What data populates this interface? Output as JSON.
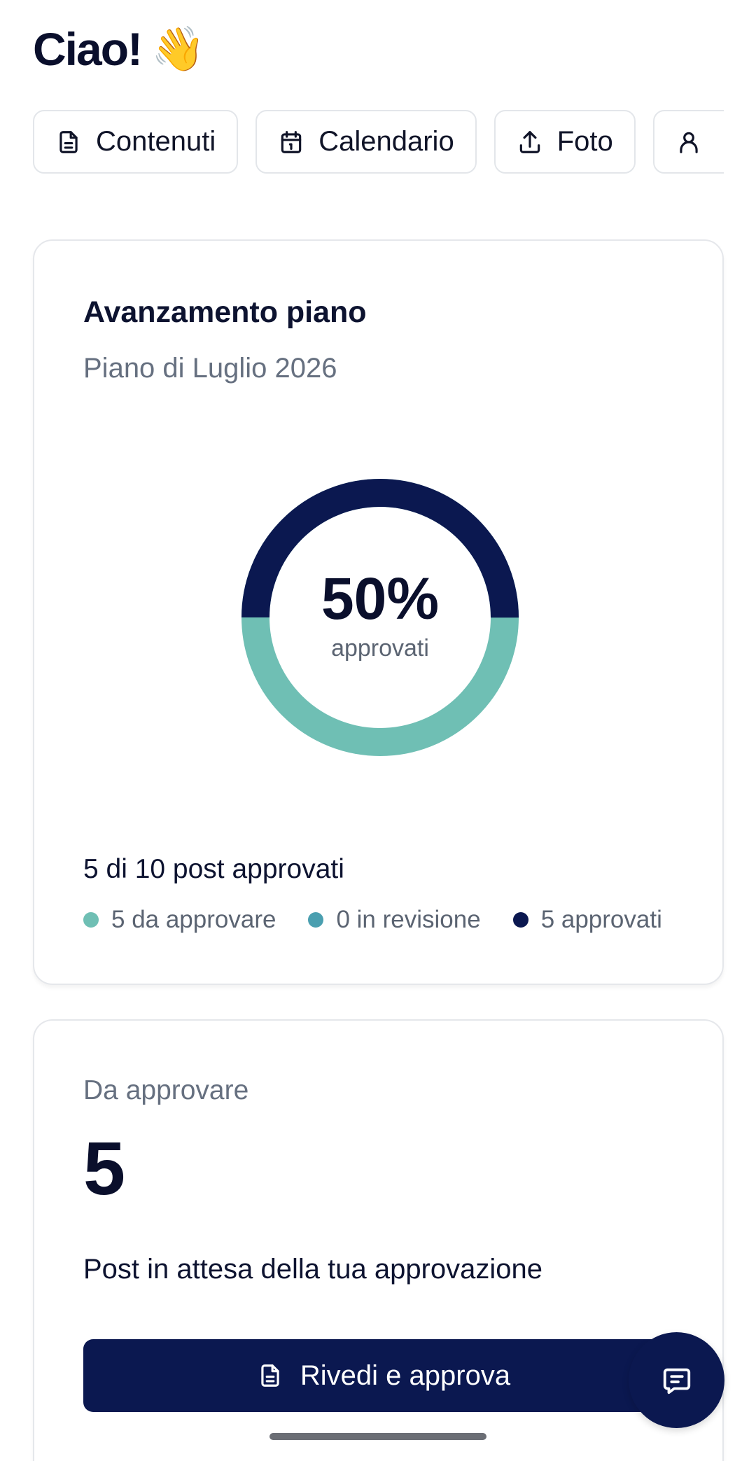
{
  "header": {
    "greeting": "Ciao!",
    "greeting_emoji": "👋"
  },
  "tabs": [
    {
      "label": "Contenuti",
      "icon": "document-icon"
    },
    {
      "label": "Calendario",
      "icon": "calendar-icon"
    },
    {
      "label": "Foto",
      "icon": "upload-icon"
    },
    {
      "label": "",
      "icon": "user-icon"
    }
  ],
  "progress_card": {
    "title": "Avanzamento piano",
    "subtitle": "Piano di Luglio 2026",
    "percent_text": "50%",
    "percent_caption": "approvati",
    "approved_fraction": 0.5,
    "count_text": "5 di 10 post approvati",
    "legend": [
      {
        "label": "5 da approvare",
        "color": "#6fbfb4"
      },
      {
        "label": "0 in revisione",
        "color": "#4a9fb0"
      },
      {
        "label": "5 approvati",
        "color": "#0b1850"
      }
    ]
  },
  "pending_card": {
    "label": "Da approvare",
    "count": "5",
    "description": "Post in attesa della tua approvazione",
    "button_label": "Rivedi e approva"
  },
  "colors": {
    "primary": "#0b1850",
    "teal": "#6fbfb4",
    "blue_teal": "#4a9fb0"
  }
}
